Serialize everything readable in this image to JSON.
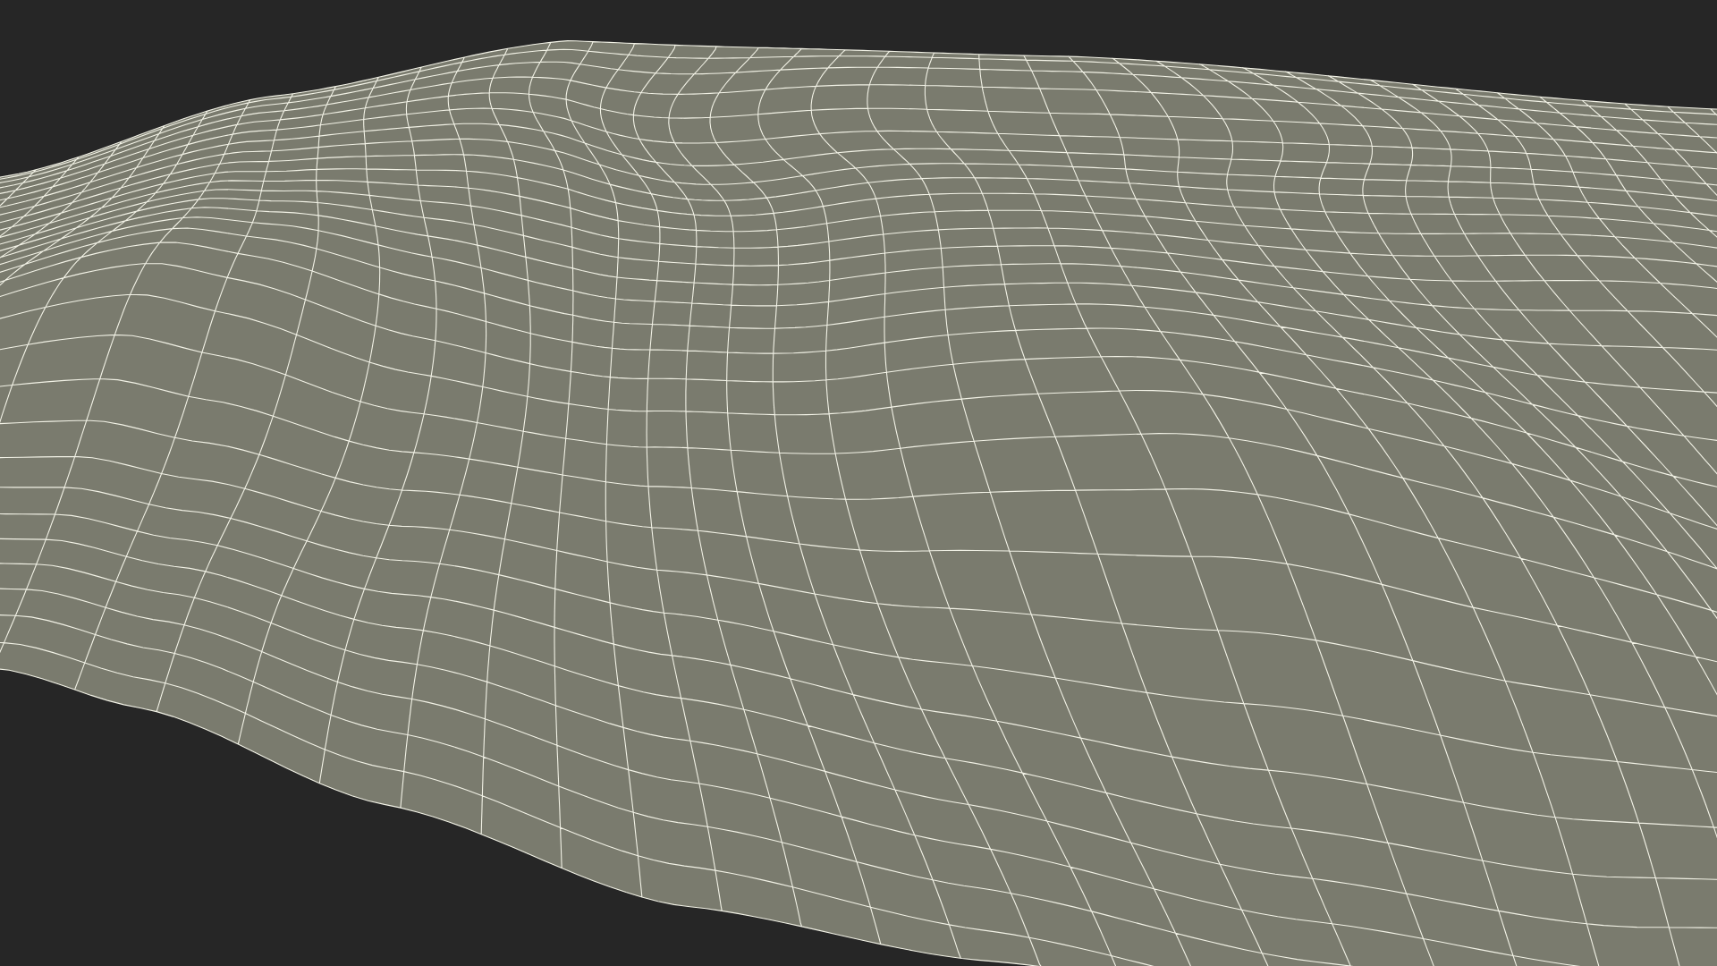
{
  "viewport": {
    "kind": "wireframe-surface"
  }
}
